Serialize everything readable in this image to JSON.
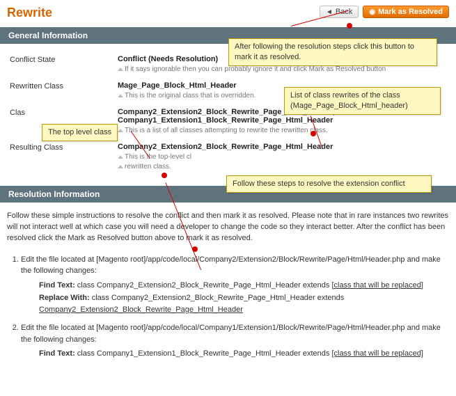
{
  "header": {
    "title": "Rewrite",
    "back_label": "Back",
    "resolve_label": "Mark as Resolved"
  },
  "callouts": {
    "top": "After following the resolution steps click this button to mark it as resolved.",
    "class_list_l1": "List of class rewrites of the class",
    "class_list_l2": "(Mage_Page_Block_Html_header)",
    "top_level": "The top level class",
    "follow_steps": "Follow these steps to resolve the extension conflict"
  },
  "sections": {
    "general_title": "General Information",
    "resolution_title": "Resolution Information"
  },
  "rows": {
    "conflict_state": {
      "label": "Conflict State",
      "value": "Conflict (Needs Resolution)",
      "hint": "If it says ignorable then you can probably ignore it and click Mark as Resolved button"
    },
    "rewritten_class": {
      "label": "Rewritten Class",
      "value": "Mage_Page_Block_Html_Header",
      "hint": "This is the original class that is overridden."
    },
    "class_rewrites": {
      "label": "Clas",
      "value": "Company2_Extension2_Block_Rewrite_Page_Html_Header, Company1_Extension1_Block_Rewrite_Page_Html_Header",
      "hint": "This is a list of all classes attempting to rewrite the rewritten class."
    },
    "resulting_class": {
      "label": "Resulting Class",
      "value": "Company2_Extension2_Block_Rewrite_Page_Html_Header",
      "hint_pre": "This is the top-level cl",
      "hint_post": "rewritten class."
    }
  },
  "resolution": {
    "intro": "Follow these simple instructions to resolve the conflict and then mark it as resolved. Please note that in rare instances two rewrites will not interact well at which case you will need a developer to change the code so they interact better. After the conflict has been resolved click the Mark as Resolved button above to mark it as resolved.",
    "steps": [
      {
        "text_pre": "Edit the file located at [Magento root]/app/code/local/Company2/Extension2/Block/Rewrite/Page/Html/Header.php and make the following changes:",
        "find_label": "Find Text:",
        "find_value_pre": "class Company2_Extension2_Block_Rewrite_Page_Html_Header extends ",
        "find_value_link": "[class that will be replaced]",
        "replace_label": "Replace With:",
        "replace_value_pre": "class Company2_Extension2_Block_Rewrite_Page_Html_Header extends ",
        "replace_value_link": "Company2_Extension2_Block_Rewrite_Page_Html_Header"
      },
      {
        "text_pre": "Edit the file located at [Magento root]/app/code/local/Company1/Extension1/Block/Rewrite/Page/Html/Header.php and make the following changes:",
        "find_label": "Find Text:",
        "find_value_pre": "class Company1_Extension1_Block_Rewrite_Page_Html_Header extends ",
        "find_value_link": "[class that will be replaced]"
      }
    ]
  }
}
